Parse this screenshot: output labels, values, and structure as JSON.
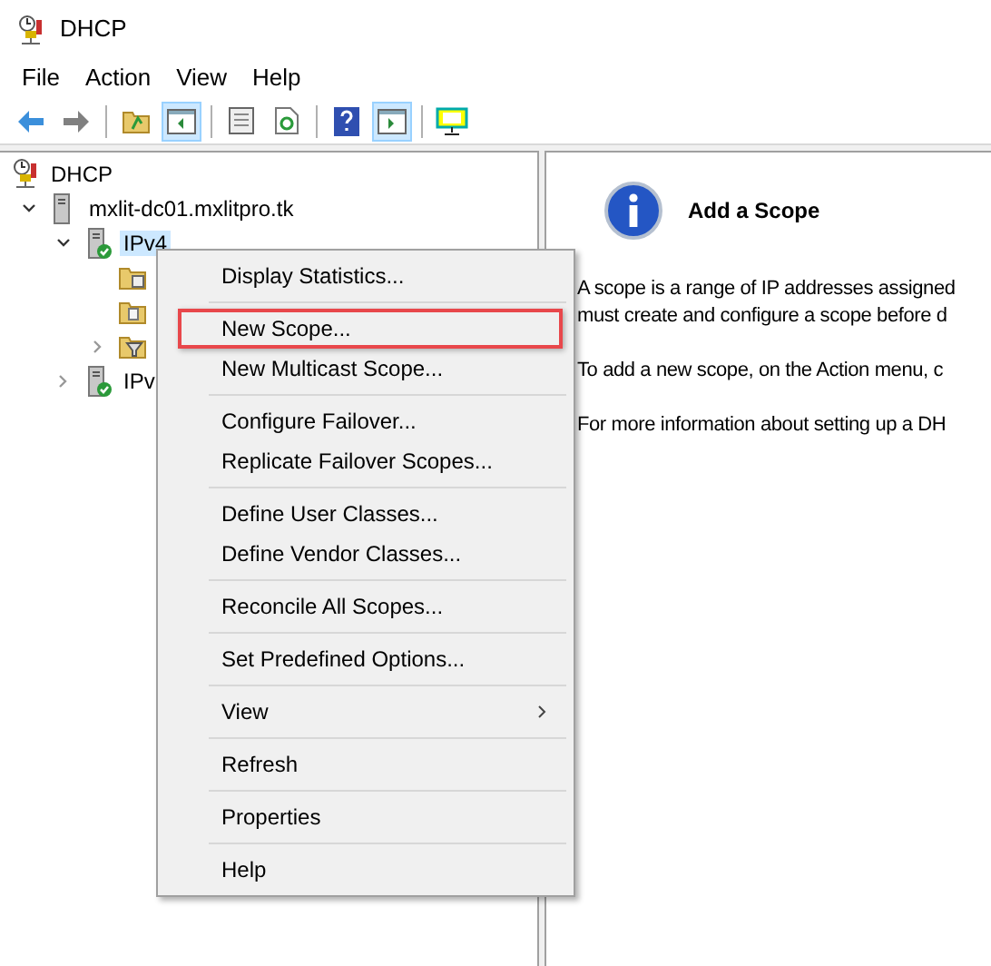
{
  "window": {
    "title": "DHCP"
  },
  "menu_bar": [
    "File",
    "Action",
    "View",
    "Help"
  ],
  "toolbar": [
    {
      "kind": "back",
      "selected": false
    },
    {
      "kind": "forward",
      "selected": false
    },
    {
      "kind": "sep"
    },
    {
      "kind": "up",
      "selected": false
    },
    {
      "kind": "tree",
      "selected": true
    },
    {
      "kind": "sep"
    },
    {
      "kind": "export",
      "selected": false
    },
    {
      "kind": "refresh",
      "selected": false
    },
    {
      "kind": "sep"
    },
    {
      "kind": "help",
      "selected": false
    },
    {
      "kind": "pane",
      "selected": true
    },
    {
      "kind": "sep"
    },
    {
      "kind": "monitor",
      "selected": false
    }
  ],
  "tree": [
    {
      "label": "DHCP",
      "kind": "dhcp",
      "selected": false,
      "children": [
        {
          "label": "mxlit-dc01.mxlitpro.tk",
          "kind": "server",
          "expanded": true,
          "selected": false,
          "children": [
            {
              "label": "IPv4",
              "kind": "ip",
              "expanded": true,
              "selected": true,
              "children": [
                {
                  "kind": "pools"
                },
                {
                  "kind": "leases"
                },
                {
                  "kind": "filters",
                  "expanded": false
                }
              ]
            },
            {
              "label": "IPv",
              "kind": "ip",
              "expanded": false,
              "selected": false
            }
          ]
        }
      ]
    }
  ],
  "info_pane": {
    "title": "Add a Scope",
    "paragraphs": [
      [
        "A scope is a range of IP addresses assigned",
        "must create and configure a scope before d"
      ],
      [
        "To add a new scope, on the Action menu, c"
      ],
      [
        "For more information about setting up a DH"
      ]
    ]
  },
  "context_menu": {
    "groups": [
      [
        {
          "label": "Display Statistics...",
          "highlighted": false,
          "submenu": false
        }
      ],
      [
        {
          "label": "New Scope...",
          "highlighted": true,
          "submenu": false
        },
        {
          "label": "New Multicast Scope...",
          "highlighted": false,
          "submenu": false
        }
      ],
      [
        {
          "label": "Configure Failover...",
          "highlighted": false,
          "submenu": false
        },
        {
          "label": "Replicate Failover Scopes...",
          "highlighted": false,
          "submenu": false
        }
      ],
      [
        {
          "label": "Define User Classes...",
          "highlighted": false,
          "submenu": false
        },
        {
          "label": "Define Vendor Classes...",
          "highlighted": false,
          "submenu": false
        }
      ],
      [
        {
          "label": "Reconcile All Scopes...",
          "highlighted": false,
          "submenu": false
        }
      ],
      [
        {
          "label": "Set Predefined Options...",
          "highlighted": false,
          "submenu": false
        }
      ],
      [
        {
          "label": "View",
          "highlighted": false,
          "submenu": true
        }
      ],
      [
        {
          "label": "Refresh",
          "highlighted": false,
          "submenu": false
        }
      ],
      [
        {
          "label": "Properties",
          "highlighted": false,
          "submenu": false
        }
      ],
      [
        {
          "label": "Help",
          "highlighted": false,
          "submenu": false
        }
      ]
    ]
  }
}
